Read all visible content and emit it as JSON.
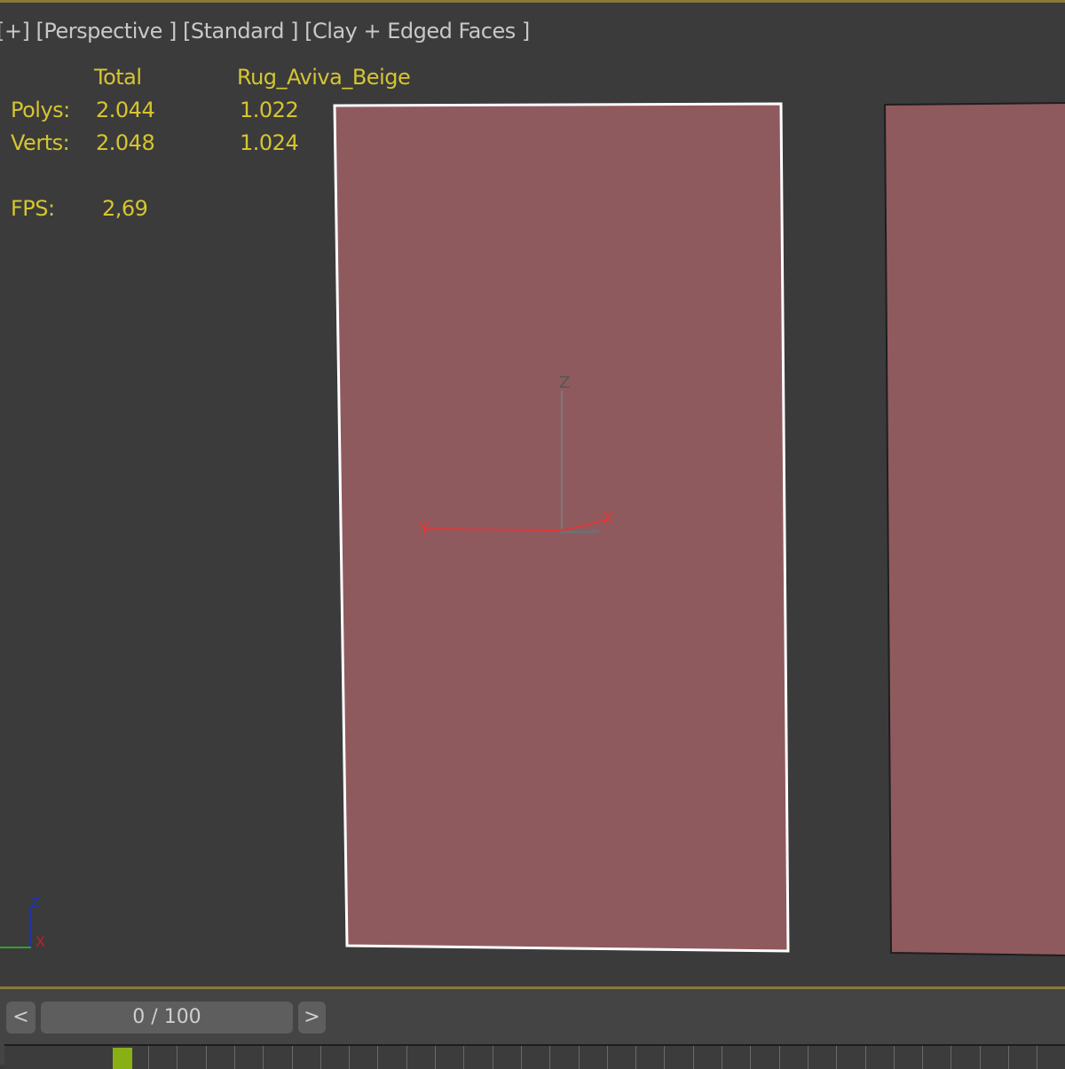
{
  "viewport": {
    "label_plus": "[+]",
    "label_view": "[Perspective ]",
    "label_shading_std": "[Standard ]",
    "label_shading": "[Clay + Edged Faces ]",
    "stats": {
      "col_total": "Total",
      "col_object": "Rug_Aviva_Beige",
      "polys_label": "Polys:",
      "polys_total": "2.044",
      "polys_object": "1.022",
      "verts_label": "Verts:",
      "verts_total": "2.048",
      "verts_object": "1.024",
      "fps_label": "FPS:",
      "fps_value": "2,69"
    },
    "gizmo": {
      "z": "Z",
      "y": "Y",
      "x": "X"
    },
    "colors": {
      "background": "#3b3b3b",
      "rug": "#8f5a5e",
      "stats_text": "#d6c530",
      "selection_edge": "#ffffff"
    }
  },
  "timeline": {
    "prev_label": "<",
    "next_label": ">",
    "frame_display": "0 / 100",
    "current_frame": 0,
    "total_frames": 100
  }
}
